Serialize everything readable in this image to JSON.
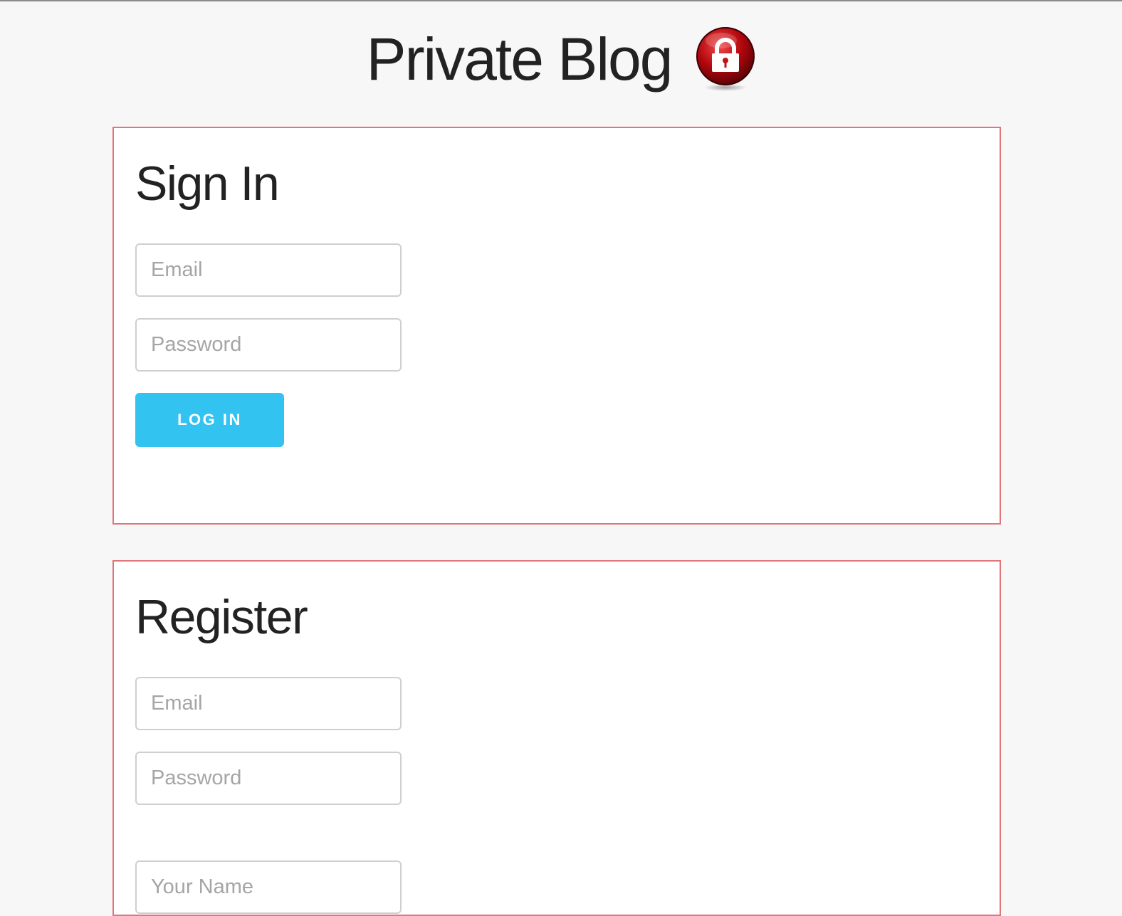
{
  "header": {
    "title": "Private Blog",
    "icon": "lock-icon",
    "icon_color": "#c4121a"
  },
  "signin": {
    "title": "Sign In",
    "email_placeholder": "Email",
    "password_placeholder": "Password",
    "login_label": "LOG IN"
  },
  "register": {
    "title": "Register",
    "email_placeholder": "Email",
    "password_placeholder": "Password",
    "name_placeholder": "Your Name"
  },
  "colors": {
    "accent": "#33c3f0",
    "panel_border": "#e0757a",
    "background": "#f7f7f7"
  }
}
